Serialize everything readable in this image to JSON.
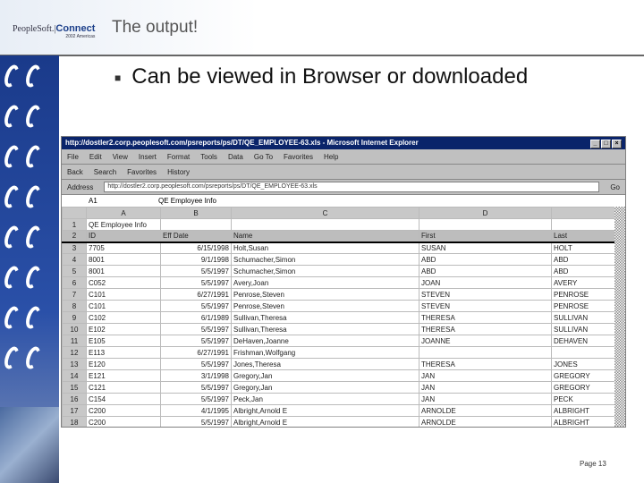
{
  "slide": {
    "title": "The output!",
    "bullet": "Can be viewed in Browser or downloaded",
    "page": "Page 13",
    "logo": {
      "brand": "PeopleSoft.",
      "product": "Connect",
      "sub": "2002 Americas"
    }
  },
  "browser": {
    "title": "http://dostler2.corp.peoplesoft.com/psreports/ps/DT/QE_EMPLOYEE-63.xls - Microsoft Internet Explorer",
    "menu": [
      "File",
      "Edit",
      "View",
      "Insert",
      "Format",
      "Tools",
      "Data",
      "Go To",
      "Favorites",
      "Help"
    ],
    "toolbar": [
      "Back",
      "Search",
      "Favorites",
      "History"
    ],
    "address_label": "Address",
    "address": "http://dostler2.corp.peoplesoft.com/psreports/ps/DT/QE_EMPLOYEE-63.xls",
    "go": "Go"
  },
  "sheet": {
    "cell_ref": "A1",
    "formula": "QE Employee Info",
    "col_letters": [
      "A",
      "B",
      "C",
      "D",
      ""
    ],
    "title": "QE Employee Info",
    "headers": [
      "ID",
      "Eff Date",
      "Name",
      "First",
      "Last"
    ],
    "rows": [
      [
        "7705",
        "6/15/1998",
        "Holt,Susan",
        "SUSAN",
        "HOLT"
      ],
      [
        "8001",
        "9/1/1998",
        "Schumacher,Simon",
        "ABD",
        "ABD"
      ],
      [
        "8001",
        "5/5/1997",
        "Schumacher,Simon",
        "ABD",
        "ABD"
      ],
      [
        "C052",
        "5/5/1997",
        "Avery,Joan",
        "JOAN",
        "AVERY"
      ],
      [
        "C101",
        "6/27/1991",
        "Penrose,Steven",
        "STEVEN",
        "PENROSE"
      ],
      [
        "C101",
        "5/5/1997",
        "Penrose,Steven",
        "STEVEN",
        "PENROSE"
      ],
      [
        "C102",
        "6/1/1989",
        "Sullivan,Theresa",
        "THERESA",
        "SULLIVAN"
      ],
      [
        "E102",
        "5/5/1997",
        "Sullivan,Theresa",
        "THERESA",
        "SULLIVAN"
      ],
      [
        "E105",
        "5/5/1997",
        "DeHaven,Joanne",
        "JOANNE",
        "DEHAVEN"
      ],
      [
        "E113",
        "6/27/1991",
        "Frishman,Wolfgang",
        "",
        ""
      ],
      [
        "E120",
        "5/5/1997",
        "Jones,Theresa",
        "THERESA",
        "JONES"
      ],
      [
        "E121",
        "3/1/1998",
        "Gregory,Jan",
        "JAN",
        "GREGORY"
      ],
      [
        "C121",
        "5/5/1997",
        "Gregory,Jan",
        "JAN",
        "GREGORY"
      ],
      [
        "C154",
        "5/5/1997",
        "Peck,Jan",
        "JAN",
        "PECK"
      ],
      [
        "C200",
        "4/1/1995",
        "Albright,Arnold E",
        "ARNOLDE",
        "ALBRIGHT"
      ],
      [
        "C200",
        "5/5/1997",
        "Albright,Arnold E",
        "ARNOLDE",
        "ALBRIGHT"
      ]
    ]
  }
}
